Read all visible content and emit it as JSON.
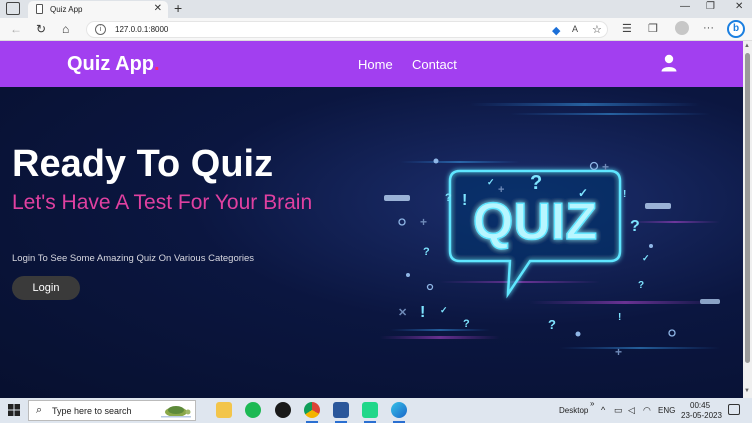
{
  "browser": {
    "tab_title": "Quiz App",
    "tab_close": "✕",
    "new_tab": "+",
    "url": "127.0.0.1:8000",
    "window_controls": [
      "—",
      "❐",
      "✕"
    ]
  },
  "site": {
    "brand": "Quiz App",
    "brand_dot": ".",
    "nav": {
      "home": "Home",
      "contact": "Contact"
    }
  },
  "hero": {
    "title": "Ready To Quiz",
    "subtitle": "Let's Have A Test For Your Brain",
    "description": "Login To See Some Amazing Quiz On Various Categories",
    "login_label": "Login"
  },
  "art": {
    "sign_text": "QUIZ"
  },
  "taskbar": {
    "search_placeholder": "Type here to search",
    "desktop_label": "Desktop",
    "more_label": "»",
    "lang": "ENG",
    "time": "00:45",
    "date": "23-05-2023"
  },
  "colors": {
    "navbar": "#a23ff0",
    "accent_pink": "#e040a0",
    "neon": "#5fe6ff"
  }
}
